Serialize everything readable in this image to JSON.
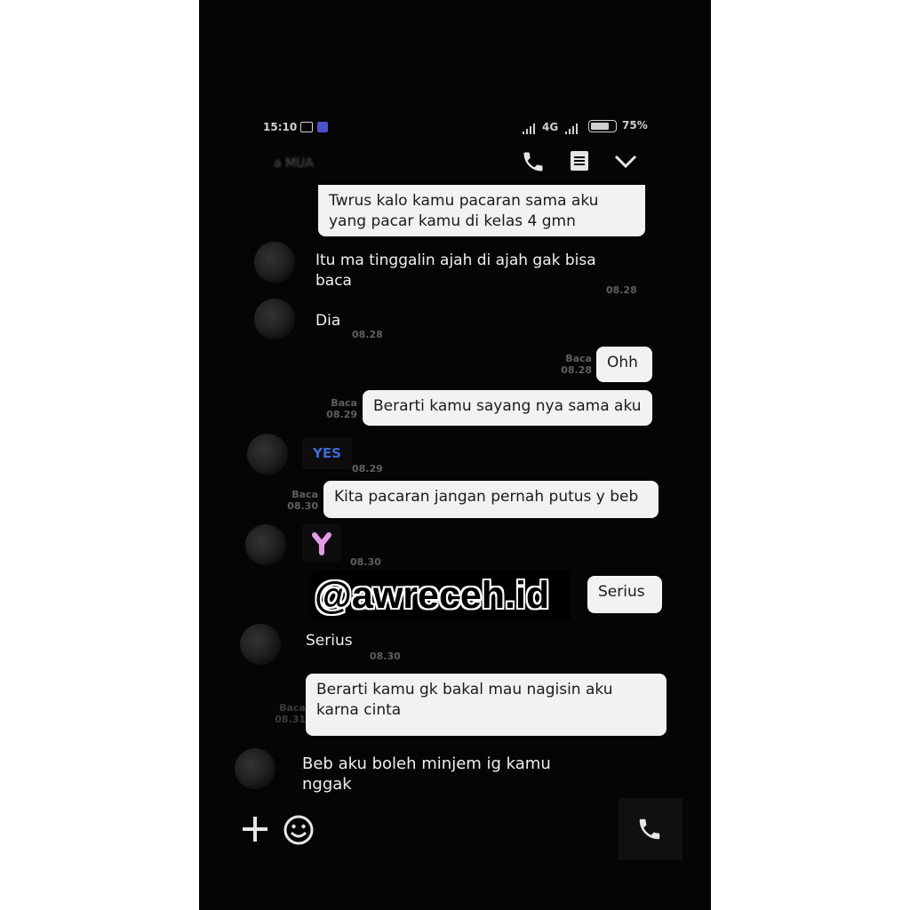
{
  "status_bar": {
    "time": "15:10",
    "network": "4G",
    "battery": "75%"
  },
  "header": {
    "contact_name": "a MUA"
  },
  "messages": {
    "m1": {
      "text_line1": "Twrus kalo kamu pacaran sama aku",
      "text_line2": "yang pacar kamu di kelas 4 gmn"
    },
    "m2": {
      "text_line1": "Itu ma tinggalin ajah di ajah gak bisa",
      "text_line2": "baca",
      "time": "08.28"
    },
    "m3": {
      "text": "Dia",
      "time": "08.28"
    },
    "m4": {
      "text": "Ohh",
      "read": "Baca",
      "time": "08.28"
    },
    "m5": {
      "text": "Berarti kamu sayang nya sama aku",
      "read": "Baca",
      "time": "08.29"
    },
    "m6": {
      "text": "YES",
      "time": "08.29"
    },
    "m7": {
      "text": "Kita pacaran jangan pernah putus y beb",
      "read": "Baca",
      "time": "08.30"
    },
    "m8": {
      "sticker": "heart-sticker",
      "time": "08.30"
    },
    "m9": {
      "text": "Serius"
    },
    "m10": {
      "text": "Serius",
      "time": "08.30"
    },
    "m11": {
      "text_line1": "Berarti kamu gk bakal mau nagisin aku",
      "text_line2": "karna cinta",
      "read": "Baca",
      "time": "08.31"
    },
    "m12": {
      "text_line1": "Beb aku boleh minjem ig kamu",
      "text_line2": "nggak"
    }
  },
  "watermark": "@awreceh.id",
  "colors": {
    "background": "#050505",
    "bubble_out": "#f2f2f2",
    "yes_text": "#3b6ad8",
    "sticker": "#e39be6"
  },
  "icons": {
    "call": "phone-icon",
    "menu": "menu-icon",
    "collapse": "chevron-down-icon",
    "add": "plus-icon",
    "emoji": "smiley-icon",
    "call_button": "phone-icon"
  }
}
